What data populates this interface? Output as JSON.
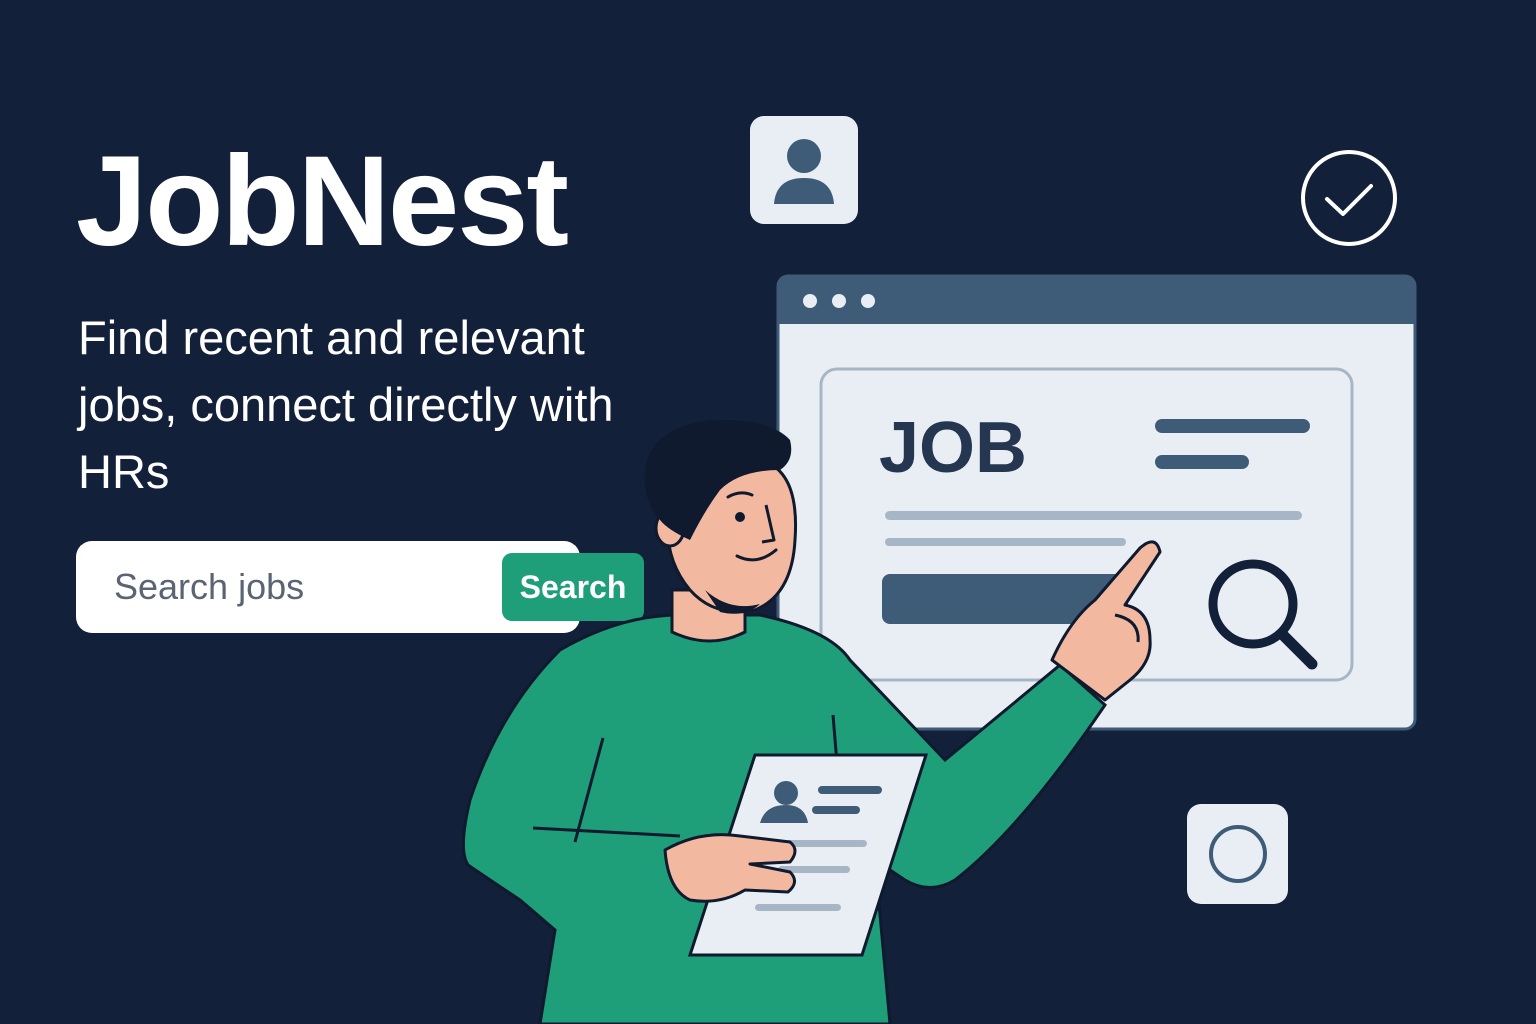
{
  "app": {
    "title": "JobNest",
    "subtitle": "Find recent and relevant jobs, connect directly with HRs"
  },
  "search": {
    "placeholder": "Search jobs",
    "button_label": "Search"
  },
  "job_card": {
    "heading": "JOB"
  },
  "icons": {
    "profile": "user-icon",
    "check": "check-circle-icon",
    "circle": "circle-icon",
    "magnifier": "magnifier-icon",
    "resume": "resume-document-icon"
  },
  "colors": {
    "background": "#13203a",
    "accent_green": "#1f9e7a",
    "card_bg": "#e9eef4",
    "window_bar": "#3e5b78",
    "text_dark": "#253650"
  }
}
